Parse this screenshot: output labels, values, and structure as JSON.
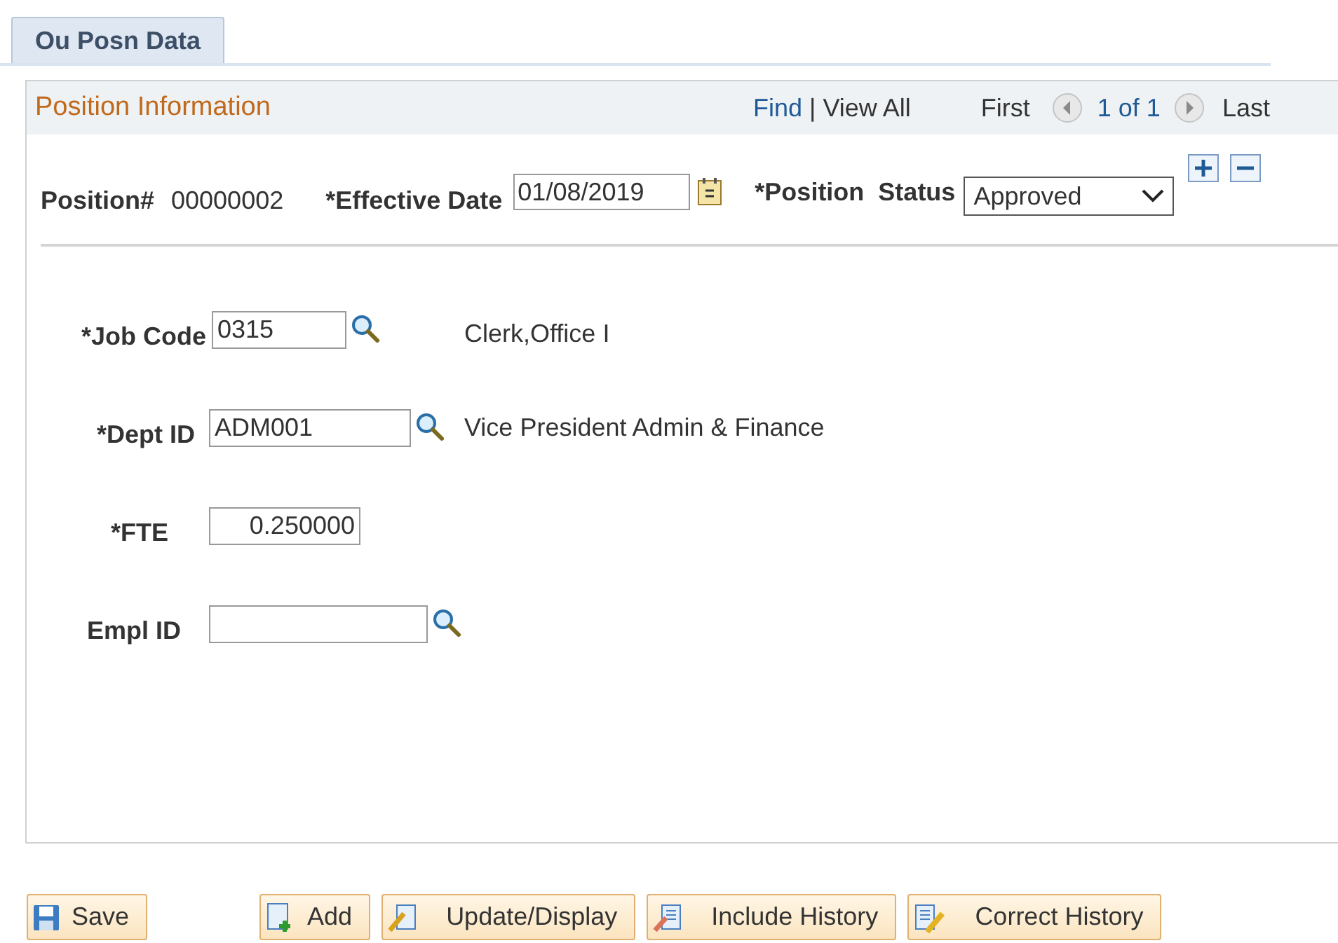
{
  "tabs": [
    {
      "label": "Ou Posn Data",
      "selected": true
    }
  ],
  "panel": {
    "title": "Position Information",
    "nav": {
      "find": "Find",
      "separator": "|",
      "view_all": "View All",
      "first": "First",
      "count": "1 of 1",
      "last": "Last"
    }
  },
  "position": {
    "label": "Position#",
    "value": "00000002",
    "effective_date_label": "*Effective Date",
    "effective_date": "01/08/2019",
    "status_label": "*Position  Status",
    "status": "Approved"
  },
  "fields": [
    {
      "label": "*Job Code",
      "value": "0315",
      "kind": "lookup",
      "description": "Clerk,Office I"
    },
    {
      "label": "*Dept ID",
      "value": "ADM001",
      "kind": "lookup",
      "description": "Vice President Admin & Finance"
    },
    {
      "label": "*FTE",
      "value": "0.250000",
      "kind": "number"
    },
    {
      "label": "Empl ID",
      "kind": "lookup"
    }
  ],
  "buttons": [
    {
      "label": "Save",
      "kind": "save"
    },
    {
      "label": "Add",
      "kind": "add"
    },
    {
      "label": "Update/Display",
      "kind": "update"
    },
    {
      "label": "Include History",
      "kind": "include"
    },
    {
      "label": "Correct History",
      "kind": "correct"
    }
  ]
}
